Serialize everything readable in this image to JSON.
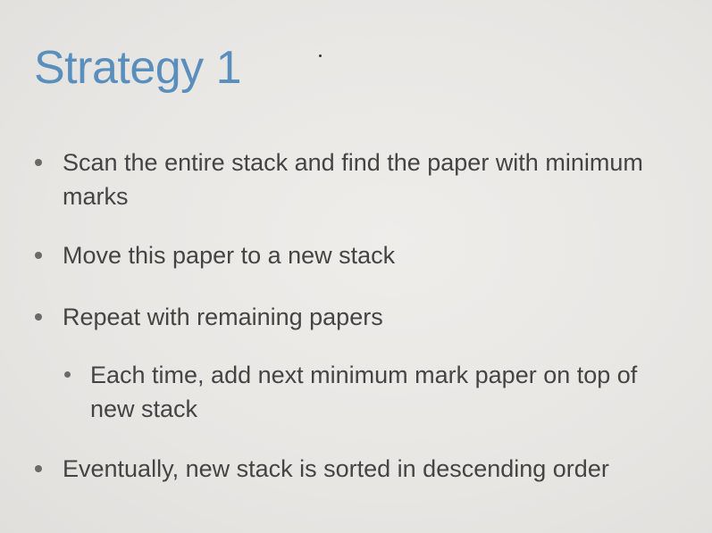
{
  "slide": {
    "title": "Strategy 1",
    "bullets": [
      "Scan the entire stack and find the paper with minimum marks",
      "Move this paper to a new stack",
      "Repeat with remaining papers",
      "Each time, add next minimum mark paper on top of new stack",
      "Eventually, new stack is sorted in descending order"
    ]
  },
  "colors": {
    "background": "#e9e7e4",
    "title": "#5a8fbd",
    "text": "#444444"
  }
}
